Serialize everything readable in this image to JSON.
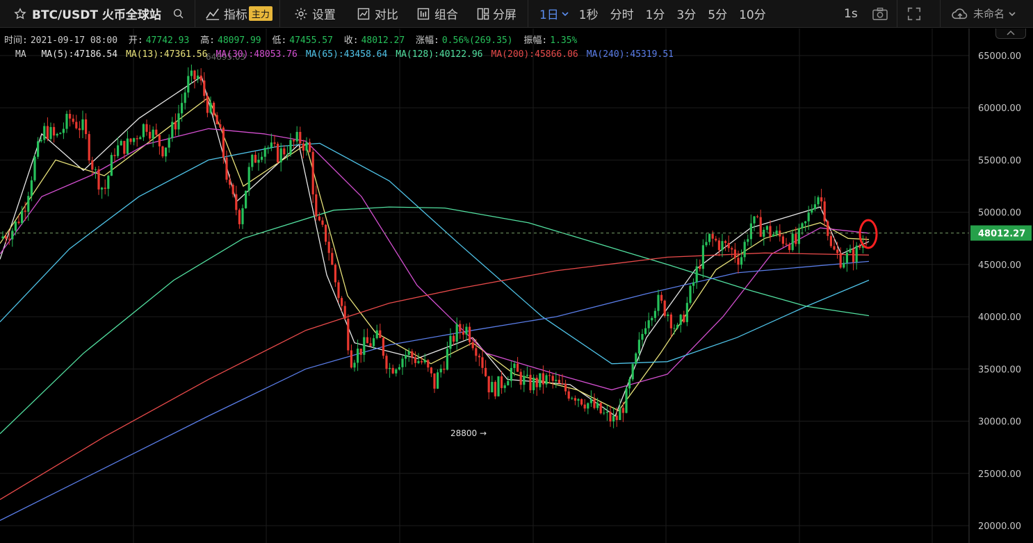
{
  "toolbar": {
    "symbol": "BTC/USDT 火币全球站",
    "indicators_label": "指标",
    "main_badge": "主力",
    "settings_label": "设置",
    "compare_label": "对比",
    "combo_label": "组合",
    "split_label": "分屏",
    "interval_selected": "1日",
    "intervals": [
      "1秒",
      "分时",
      "1分",
      "3分",
      "5分",
      "10分"
    ],
    "refresh_label": "1s",
    "unnamed_label": "未命名"
  },
  "info": {
    "time_label": "时间:",
    "time_value": "2021-09-17 08:00",
    "open_label": "开:",
    "open_value": "47742.93",
    "high_label": "高:",
    "high_value": "48097.99",
    "low_label": "低:",
    "low_value": "47455.57",
    "close_label": "收:",
    "close_value": "48012.27",
    "change_label": "涨幅:",
    "change_value": "0.56%(269.35)",
    "amp_label": "振幅:",
    "amp_value": "1.35%"
  },
  "ma_legend": {
    "label": "MA",
    "items": [
      {
        "text": "MA(5):47186.54",
        "color": "#e8e8e8"
      },
      {
        "text": "MA(13):47361.56",
        "color": "#e8e27a"
      },
      {
        "text": "MA(30):48053.76",
        "color": "#d34fd0"
      },
      {
        "text": "MA(65):43458.64",
        "color": "#4fc3e8"
      },
      {
        "text": "MA(128):40122.96",
        "color": "#52e0a0"
      },
      {
        "text": "MA(200):45866.06",
        "color": "#e84a4a"
      },
      {
        "text": "MA(240):45319.51",
        "color": "#5a7de8"
      }
    ]
  },
  "price_axis": {
    "ticks": [
      65000,
      60000,
      55000,
      50000,
      45000,
      40000,
      35000,
      30000,
      25000,
      20000
    ],
    "tick_labels": [
      "65000.00",
      "60000.00",
      "55000.00",
      "50000.00",
      "45000.00",
      "40000.00",
      "35000.00",
      "30000.00",
      "25000.00",
      "20000.00"
    ],
    "current_price": 48012.27,
    "current_label": "48012.27"
  },
  "annotations": {
    "low_marker": "28800 →",
    "high_marker": "64895.03"
  },
  "colors": {
    "up": "#26c05a",
    "down": "#e8382f",
    "current_tag": "#26a04a",
    "circle": "#ff2020"
  }
}
